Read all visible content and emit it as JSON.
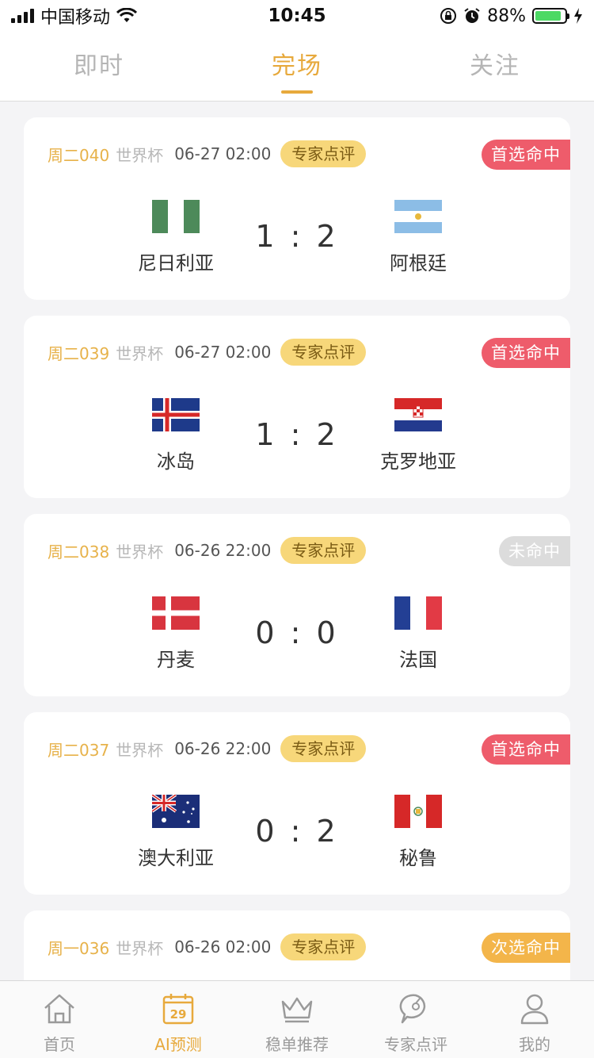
{
  "status_bar": {
    "carrier": "中国移动",
    "time": "10:45",
    "battery": "88%",
    "battery_level": 0.88
  },
  "tabs": [
    {
      "label": "即时",
      "active": false
    },
    {
      "label": "完场",
      "active": true
    },
    {
      "label": "关注",
      "active": false
    }
  ],
  "matches": [
    {
      "match_no": "周二040",
      "league": "世界杯",
      "time": "06-27 02:00",
      "tag": "专家点评",
      "result": "首选命中",
      "result_color": "#ee5c6b",
      "home": {
        "name": "尼日利亚",
        "flag": "nigeria-flag-icon"
      },
      "away": {
        "name": "阿根廷",
        "flag": "argentina-flag-icon"
      },
      "score": "1 : 2"
    },
    {
      "match_no": "周二039",
      "league": "世界杯",
      "time": "06-27 02:00",
      "tag": "专家点评",
      "result": "首选命中",
      "result_color": "#ee5c6b",
      "home": {
        "name": "冰岛",
        "flag": "iceland-flag-icon"
      },
      "away": {
        "name": "克罗地亚",
        "flag": "croatia-flag-icon"
      },
      "score": "1 : 2"
    },
    {
      "match_no": "周二038",
      "league": "世界杯",
      "time": "06-26 22:00",
      "tag": "专家点评",
      "result": "未命中",
      "result_color": "#dcdcdc",
      "home": {
        "name": "丹麦",
        "flag": "denmark-flag-icon"
      },
      "away": {
        "name": "法国",
        "flag": "france-flag-icon"
      },
      "score": "0 : 0"
    },
    {
      "match_no": "周二037",
      "league": "世界杯",
      "time": "06-26 22:00",
      "tag": "专家点评",
      "result": "首选命中",
      "result_color": "#ee5c6b",
      "home": {
        "name": "澳大利亚",
        "flag": "australia-flag-icon"
      },
      "away": {
        "name": "秘鲁",
        "flag": "peru-flag-icon"
      },
      "score": "0 : 2"
    },
    {
      "match_no": "周一036",
      "league": "世界杯",
      "time": "06-26 02:00",
      "tag": "专家点评",
      "result": "次选命中",
      "result_color": "#f3b54a"
    }
  ],
  "bottom_nav": [
    {
      "label": "首页",
      "icon": "home-icon",
      "active": false
    },
    {
      "label": "AI预测",
      "icon": "calendar-29-icon",
      "active": true,
      "icon_text": "29"
    },
    {
      "label": "稳单推荐",
      "icon": "crown-icon",
      "active": false
    },
    {
      "label": "专家点评",
      "icon": "comment-icon",
      "active": false
    },
    {
      "label": "我的",
      "icon": "user-icon",
      "active": false
    }
  ],
  "colors": {
    "accent": "#e7a93c",
    "hit": "#ee5c6b",
    "miss": "#dcdcdc",
    "second_hit": "#f3b54a"
  }
}
